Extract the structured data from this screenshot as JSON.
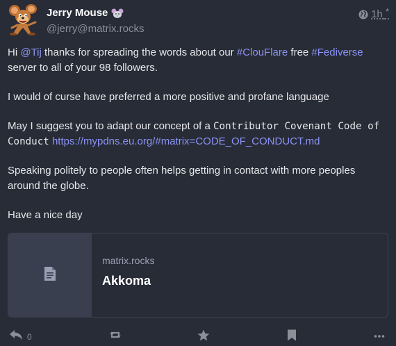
{
  "author": {
    "display_name": "Jerry Mouse",
    "handle": "@jerry@matrix.rocks"
  },
  "meta": {
    "time": "1h",
    "edited_mark": "*",
    "visibility_icon": "globe-icon"
  },
  "content": {
    "p1": {
      "t1": "Hi ",
      "mention": "@Tij",
      "t2": " thanks for spreading the words about our ",
      "tag1": "#ClouFlare",
      "t3": " free ",
      "tag2": "#Fediverse",
      "t4": " server to all of your 98 followers."
    },
    "p2": "I would of curse have preferred a more positive and profane language",
    "p3": {
      "t1": "May I suggest you to adapt our concept of a ",
      "code": "Contributor Covenant Code of Conduct",
      "t2": " ",
      "link": "https://mypdns.eu.org/#matrix=CODE_OF_CONDUCT.md"
    },
    "p4": "Speaking politely to people often helps getting in contact with more peoples around the globe.",
    "p5": "Have a nice day"
  },
  "card": {
    "host": "matrix.rocks",
    "title": "Akkoma",
    "icon": "document-icon"
  },
  "actions": {
    "reply_count": "0",
    "reply_icon": "reply-icon",
    "boost_icon": "retweet-icon",
    "favourite_icon": "star-icon",
    "bookmark_icon": "bookmark-icon",
    "more_icon": "ellipsis-icon"
  },
  "colors": {
    "background": "#282c37",
    "link": "#8b93f5",
    "muted": "#8a8f98",
    "card_thumb": "#393f4f"
  }
}
